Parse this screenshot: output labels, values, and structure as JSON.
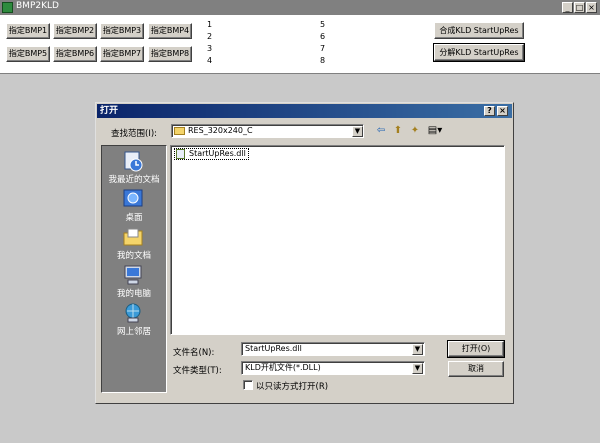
{
  "app": {
    "title": "BMP2KLD",
    "window_buttons": [
      "_",
      "□",
      "×"
    ]
  },
  "main": {
    "bmp_buttons": [
      "指定BMP1",
      "指定BMP2",
      "指定BMP3",
      "指定BMP4",
      "指定BMP5",
      "指定BMP6",
      "指定BMP7",
      "指定BMP8"
    ],
    "number_labels": [
      "1",
      "2",
      "3",
      "4",
      "5",
      "6",
      "7",
      "8"
    ],
    "compose_button": "合成KLD StartUpRes",
    "split_button": "分解KLD StartUpRes"
  },
  "dialog": {
    "title": "打开",
    "help_button": "?",
    "close_button": "×",
    "look_in_label": "查找范围(I):",
    "look_in_value": "RES_320x240_C",
    "places": [
      {
        "label": "我最近的文档",
        "icon": "recent-documents-icon"
      },
      {
        "label": "桌面",
        "icon": "desktop-icon"
      },
      {
        "label": "我的文档",
        "icon": "my-documents-icon"
      },
      {
        "label": "我的电脑",
        "icon": "my-computer-icon"
      },
      {
        "label": "网上邻居",
        "icon": "network-icon"
      }
    ],
    "files": [
      "StartUpRes.dll"
    ],
    "filename_label": "文件名(N):",
    "filename_value": "StartUpRes.dll",
    "filetype_label": "文件类型(T):",
    "filetype_value": "KLD开机文件(*.DLL)",
    "readonly_label": "以只读方式打开(R)",
    "open_button": "打开(O)",
    "cancel_button": "取消"
  },
  "colors": {
    "titlebar_active": "#0a246a",
    "titlebar_inactive": "#808080",
    "face": "#d4d0c8"
  }
}
